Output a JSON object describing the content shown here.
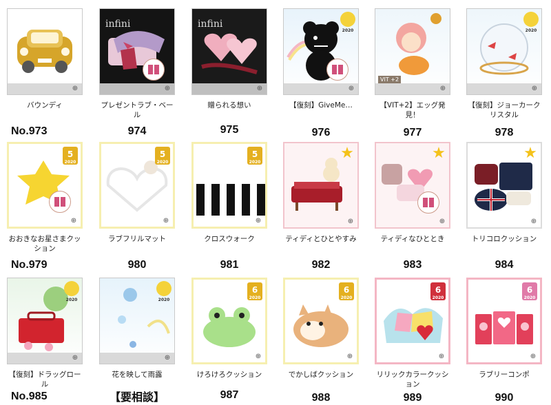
{
  "rows": [
    [
      {
        "name": "バウンディ",
        "num": "No.973",
        "theme": "car"
      },
      {
        "name": "プレゼントラブ・ベール",
        "num": "974",
        "theme": "dark-box"
      },
      {
        "name": "贈られる想い",
        "num": "975",
        "theme": "dark-hearts"
      },
      {
        "name": "【復刻】GiveMe…",
        "num": "976",
        "theme": "bear",
        "badge_year": "2020"
      },
      {
        "name": "【VIT+2】エッグ発見！",
        "num": "977",
        "theme": "egg",
        "tag": "VIT +2"
      },
      {
        "name": "【復刻】ジョーカークリスタル",
        "num": "978",
        "theme": "crystal",
        "badge_year": "2020"
      }
    ],
    [
      {
        "name": "おおきなお星さまクッション",
        "num": "No.979",
        "theme": "star-cushion",
        "badge": "5",
        "badge_year": "2020"
      },
      {
        "name": "ラブフリルマット",
        "num": "980",
        "theme": "frill",
        "badge": "5",
        "badge_year": "2020"
      },
      {
        "name": "クロスウォーク",
        "num": "981",
        "theme": "crosswalk",
        "badge": "5",
        "badge_year": "2020"
      },
      {
        "name": "ティディとひとやすみ",
        "num": "982",
        "theme": "teddy-bed"
      },
      {
        "name": "ティディなひととき",
        "num": "983",
        "theme": "teddy-pillows"
      },
      {
        "name": "トリコロクッション",
        "num": "984",
        "theme": "tricolor"
      }
    ],
    [
      {
        "name": "【復刻】ドラッグロール",
        "num": "No.985",
        "theme": "red-box",
        "badge_year": "2020"
      },
      {
        "name": "花を映して雨露",
        "num": "【要相談】",
        "theme": "rain",
        "badge_year": "2020"
      },
      {
        "name": "けろけろクッション",
        "num": "987",
        "theme": "frog",
        "badge": "6",
        "badge_year": "2020"
      },
      {
        "name": "でかしばクッション",
        "num": "988",
        "theme": "shiba",
        "badge": "6",
        "badge_year": "2020"
      },
      {
        "name": "リリックカラークッション",
        "num": "989",
        "theme": "lyric",
        "badge": "6",
        "badge_year": "2020"
      },
      {
        "name": "ラブリーコンポ",
        "num": "990",
        "theme": "stereo",
        "badge": "6",
        "badge_year": "2020"
      }
    ]
  ],
  "colors": {
    "badge_gold": "#e4b020",
    "badge_red": "#d0303c",
    "badge_pink": "#e07aa8",
    "thumb_border": "#c9c9c9"
  }
}
